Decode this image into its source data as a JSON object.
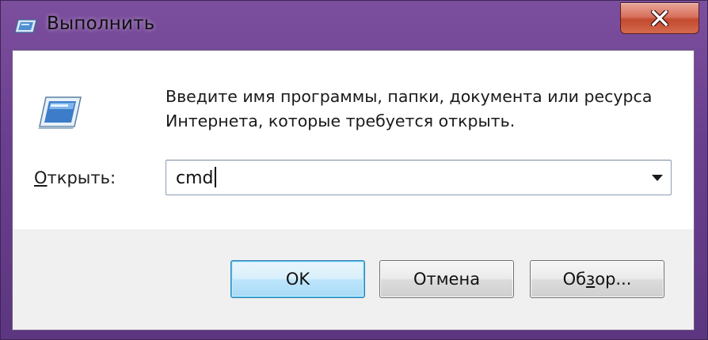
{
  "window": {
    "title": "Выполнить",
    "title_icon": "run-dialog-icon",
    "close_icon": "close-icon"
  },
  "dialog": {
    "icon": "run-program-icon",
    "description": "Введите имя программы, папки, документа или ресурса\nИнтернета, которые требуется открыть.",
    "open_label_accel": "О",
    "open_label_rest": "ткрыть:",
    "input_value": "cmd",
    "dropdown_icon": "chevron-down-icon"
  },
  "buttons": {
    "ok_label": "OK",
    "cancel_label": "Отмена",
    "browse_label_pre": "Об",
    "browse_label_accel": "з",
    "browse_label_post": "ор..."
  },
  "colors": {
    "frame": "#6b3f8f",
    "close_button": "#c24a2f",
    "default_button_border": "#3c7fb1",
    "client_bottom": "#f0f0f0"
  }
}
